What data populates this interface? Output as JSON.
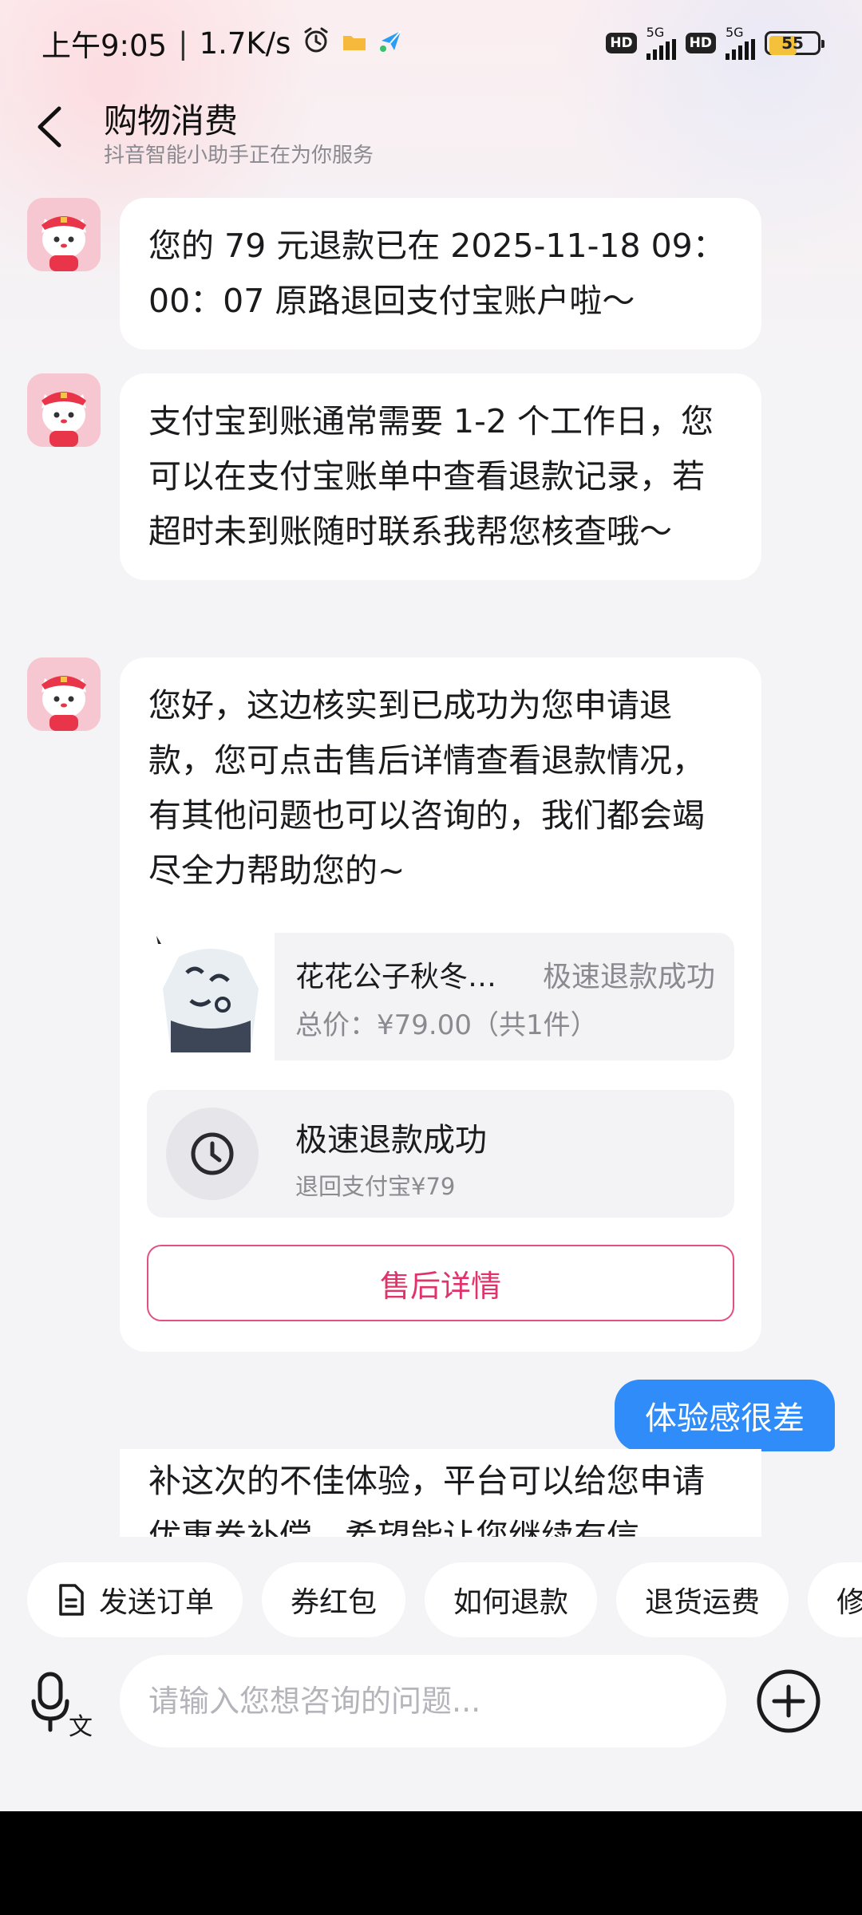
{
  "status_bar": {
    "time": "上午9:05",
    "speed": "1.7K/s",
    "sim1_hd": "HD",
    "sim1_net": "5G",
    "sim2_hd": "HD",
    "sim2_net": "5G",
    "battery": "55",
    "icons": [
      "alarm-icon",
      "folder-notification-icon",
      "send-notification-icon"
    ]
  },
  "header": {
    "title": "购物消费",
    "subtitle": "抖音智能小助手正在为你服务"
  },
  "messages": {
    "msg1": "您的 79 元退款已在 2025-11-18 09：00：07 原路退回支付宝账户啦～",
    "msg2": "支付宝到账通常需要 1-2 个工作日，您可以在支付宝账单中查看退款记录，若超时未到账随时联系我帮您核查哦～",
    "msg3": "您好，这边核实到已成功为您申请退款，您可点击售后详情查看退款情况，有其他问题也可以咨询的，我们都会竭尽全力帮助您的~",
    "order": {
      "name": "花花公子秋冬…",
      "status": "极速退款成功",
      "price": "总价：¥79.00（共1件）"
    },
    "refund": {
      "title": "极速退款成功",
      "detail": "退回支付宝¥79"
    },
    "after_sale_button": "售后详情",
    "user_msg": "体验感很差",
    "partial_msg": "补这次的不佳体验，平台可以给您申请优惠券补偿，希望能让您继续有信"
  },
  "quick_replies": [
    "发送订单",
    "券红包",
    "如何退款",
    "退货运费",
    "修"
  ],
  "input": {
    "placeholder": "请输入您想咨询的问题..."
  },
  "colors": {
    "accent": "#e0336b",
    "user_bubble": "#2f8cf8",
    "battery": "#f4c23a"
  }
}
